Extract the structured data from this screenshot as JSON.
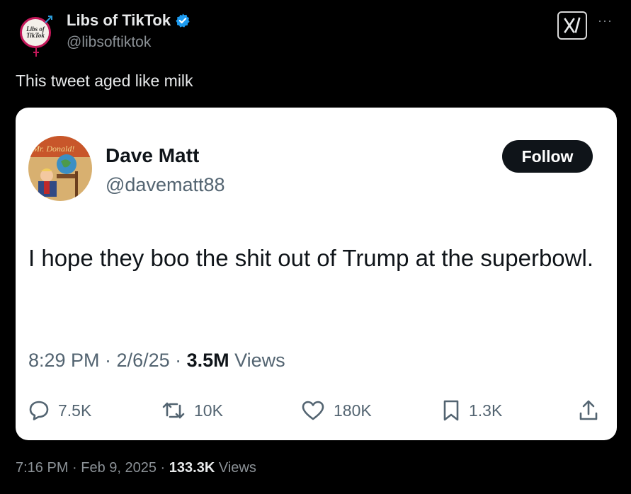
{
  "post": {
    "author_name": "Libs of TikTok",
    "author_handle": "@libsoftiktok",
    "avatar_text_line1": "Libs of",
    "avatar_text_line2": "TikTok",
    "text": "This tweet aged like milk",
    "timestamp": "7:16 PM · Feb 9, 2025 · ",
    "views_count": "133.3K",
    "views_label": " Views",
    "icons": {
      "verified": "verified-badge-icon",
      "grok": "grok-icon",
      "more": "more-icon"
    },
    "accent_color": "#1d9bf0"
  },
  "quoted": {
    "author_name": "Dave Matt",
    "author_handle": "@davematt88",
    "avatar_sign_text": "Mr. Donald!",
    "follow_label": "Follow",
    "text": "I hope they boo the shit out of Trump at the superbowl.",
    "timestamp": "8:29 PM · 2/6/25 · ",
    "views_count": "3.5M",
    "views_label": " Views",
    "actions": {
      "replies": "7.5K",
      "reposts": "10K",
      "likes": "180K",
      "bookmarks": "1.3K"
    }
  }
}
